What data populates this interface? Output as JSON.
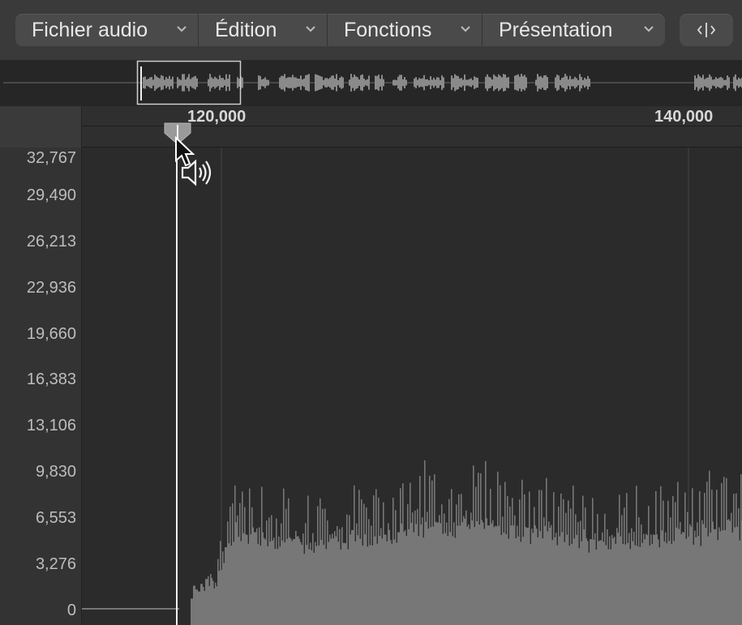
{
  "menubar": {
    "items": [
      {
        "label": "Fichier audio"
      },
      {
        "label": "Édition"
      },
      {
        "label": "Fonctions"
      },
      {
        "label": "Présentation"
      }
    ],
    "split_icon": "split-view-icon"
  },
  "ruler": {
    "markers": [
      "120,000",
      "140,000"
    ]
  },
  "amplitude_axis": {
    "labels": [
      "32,767",
      "29,490",
      "26,213",
      "22,936",
      "19,660",
      "16,383",
      "13,106",
      "9,830",
      "6,553",
      "3,276",
      "0"
    ]
  },
  "icons": {
    "playhead": "playhead-handle-icon",
    "cursor": "arrow-cursor-icon",
    "speaker": "speaker-icon"
  },
  "colors": {
    "background": "#2b2b2b",
    "waveform": "#7a7a7a",
    "playhead": "#f2f2f2"
  }
}
